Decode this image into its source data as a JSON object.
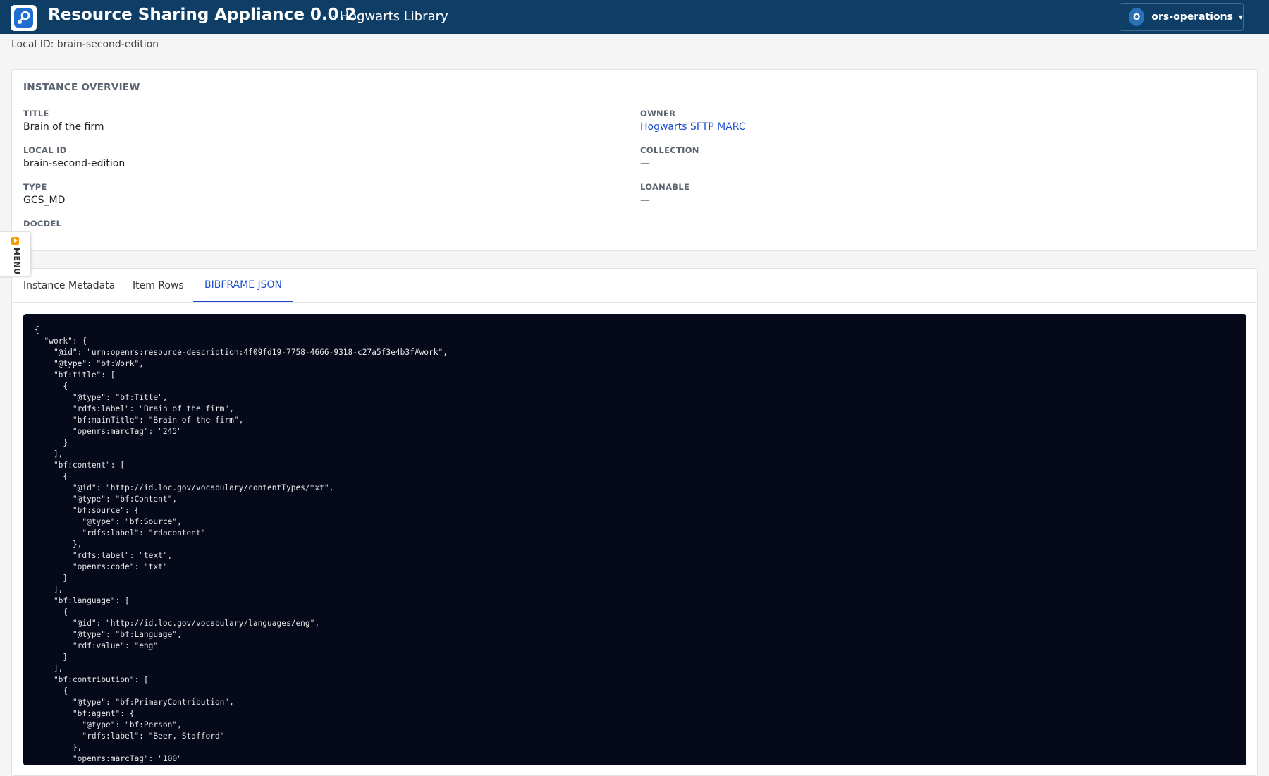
{
  "header": {
    "app_title": "Resource Sharing Appliance 0.0.2",
    "app_subtitle": "· Hogwarts Library",
    "logo_icon": "share-nodes-icon",
    "user": {
      "initial": "O",
      "name": "ors-operations",
      "caret": "▾"
    }
  },
  "local_id_line": "Local ID: brain-second-edition",
  "overview": {
    "section_title": "INSTANCE OVERVIEW",
    "title_label": "TITLE",
    "title_value": "Brain of the firm",
    "local_id_label": "LOCAL ID",
    "local_id_value": "brain-second-edition",
    "type_label": "TYPE",
    "type_value": "GCS_MD",
    "docdel_label": "DOCDEL",
    "owner_label": "OWNER",
    "owner_value": "Hogwarts SFTP MARC",
    "collection_label": "COLLECTION",
    "collection_value": "—",
    "loanable_label": "LOANABLE",
    "loanable_value": "—"
  },
  "side_menu": {
    "label": "MENU",
    "icon": "play-icon"
  },
  "tabs": [
    {
      "label": "Instance Metadata",
      "active": false
    },
    {
      "label": "Item Rows",
      "active": false
    },
    {
      "label": "BIBFRAME JSON",
      "active": true
    }
  ],
  "json_lines": [
    "{",
    "  \"work\": {",
    "    \"@id\": \"urn:openrs:resource-description:4f09fd19-7758-4666-9318-c27a5f3e4b3f#work\",",
    "    \"@type\": \"bf:Work\",",
    "    \"bf:title\": [",
    "      {",
    "        \"@type\": \"bf:Title\",",
    "        \"rdfs:label\": \"Brain of the firm\",",
    "        \"bf:mainTitle\": \"Brain of the firm\",",
    "        \"openrs:marcTag\": \"245\"",
    "      }",
    "    ],",
    "    \"bf:content\": [",
    "      {",
    "        \"@id\": \"http://id.loc.gov/vocabulary/contentTypes/txt\",",
    "        \"@type\": \"bf:Content\",",
    "        \"bf:source\": {",
    "          \"@type\": \"bf:Source\",",
    "          \"rdfs:label\": \"rdacontent\"",
    "        },",
    "        \"rdfs:label\": \"text\",",
    "        \"openrs:code\": \"txt\"",
    "      }",
    "    ],",
    "    \"bf:language\": [",
    "      {",
    "        \"@id\": \"http://id.loc.gov/vocabulary/languages/eng\",",
    "        \"@type\": \"bf:Language\",",
    "        \"rdf:value\": \"eng\"",
    "      }",
    "    ],",
    "    \"bf:contribution\": [",
    "      {",
    "        \"@type\": \"bf:PrimaryContribution\",",
    "        \"bf:agent\": {",
    "          \"@type\": \"bf:Person\",",
    "          \"rdfs:label\": \"Beer, Stafford\"",
    "        },",
    "        \"openrs:marcTag\": \"100\""
  ]
}
